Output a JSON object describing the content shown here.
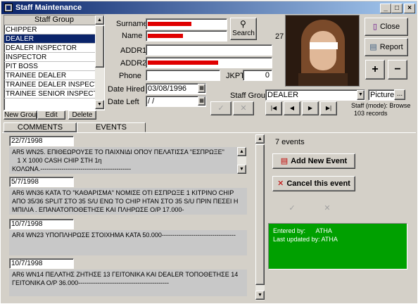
{
  "window": {
    "title": "Staff Maintenance",
    "minimize": "_",
    "maximize": "□",
    "close": "×"
  },
  "staff_group_list": {
    "header": "Staff Group",
    "items": [
      {
        "label": "CHIPPER"
      },
      {
        "label": "DEALER"
      },
      {
        "label": "DEALER INSPECTOR"
      },
      {
        "label": "INSPECTOR"
      },
      {
        "label": "PIT BOSS"
      },
      {
        "label": "TRAINEE DEALER"
      },
      {
        "label": "TRAINEE DEALER INSPECTOR"
      },
      {
        "label": "TRAINEE SENIOR INSPECTOR"
      }
    ],
    "selected_index": 1,
    "buttons": {
      "new": "New Group",
      "edit": "Edit",
      "delete": "Delete"
    }
  },
  "form": {
    "surname_label": "Surname",
    "name_label": "Name",
    "addr1_label": "ADDR1",
    "addr2_label": "ADDR2",
    "phone_label": "Phone",
    "jkpt_label": "JKPT",
    "jkpt_value": "0",
    "date_hired_label": "Date Hired",
    "date_hired_value": "03/08/1996",
    "date_left_label": "Date Left",
    "date_left_value": " /  /",
    "search_label": "Search",
    "record_number": "27",
    "staff_group_label": "Staff Group",
    "staff_group_value": "DEALER",
    "picture_label": "Picture",
    "picture_button": "...",
    "staff_mode": "Staff (mode): Browse",
    "records": "103 records",
    "confirm_glyph": "✓",
    "cancel_glyph": "✕"
  },
  "actions": {
    "close": "Close",
    "report": "Report",
    "plus": "+",
    "minus": "−"
  },
  "nav": {
    "first": "|◀",
    "prev": "◀",
    "next": "▶",
    "last": "▶|"
  },
  "tabs": {
    "comments": "COMMENTS",
    "events": "EVENTS"
  },
  "events": {
    "count_label": "7 events",
    "add_button": "Add New Event",
    "cancel_button": "Cancel this event",
    "entered_by": "Entered by:      ATHA",
    "last_updated_by": "Last updated by: ATHA",
    "items": [
      {
        "date": "22/7/1998",
        "text": "AR5 WN25. ΕΠΙΘΕΩΡΟΥΣΕ ΤΟ ΠΑΙΧΝΙΔΙ ΟΠΟΥ ΠΕΛΑΤΙΣΣΑ \"ΕΣΠΡΩΞΕ\"\n   1 X 1000 CASH CHIP ΣΤΗ 1η\nΚΟΛΩΝΑ.-------------------------------------------"
      },
      {
        "date": "5/7/1998",
        "text": "AR6 WN36 ΚΑΤΑ ΤΟ \"ΚΑΘΑΡΙΣΜΑ\" ΝΟΜΙΣΕ ΟΤΙ ΕΣΠΡΩΞΕ 1 ΚΙΤΡΙΝΟ CHIP ΑΠΟ 35/36 SPLIT ΣΤΟ 35 S/U ΕΝΩ ΤΟ CHIP ΗΤΑΝ ΣΤΟ 35 S/U ΠΡΙΝ ΠΕΣΕΙ Η ΜΠΙΛΙΑ . ΕΠΑΝΑΤΟΠΟΘΕΤΗΣΕ ΚΑΙ ΠΛΗΡΩΣΕ Ο/Ρ 17.000-"
      },
      {
        "date": "10/7/1998",
        "text": "AR4 WN23 ΥΠΟΠΛΗΡΩΣΕ ΣΤΟΙΧΗΜΑ ΚΑΤΑ 50.000-----------------------------------"
      },
      {
        "date": "10/7/1998",
        "text": "AR6 WN14 ΠΕΛΑΤΗΣ ΖΗΤΗΣΕ 13 ΓΕΙΤΟΝΙΚΑ ΚΑΙ DEALER ΤΟΠΟΘΕΤΗΣΕ 14 ΓΕΙΤΟΝΙΚΑ Ο/Ρ 36.000-------------------------------------------"
      }
    ]
  },
  "colors": {
    "selection": "#0a246a",
    "green_panel": "#00a000",
    "redaction": "#e00000"
  }
}
